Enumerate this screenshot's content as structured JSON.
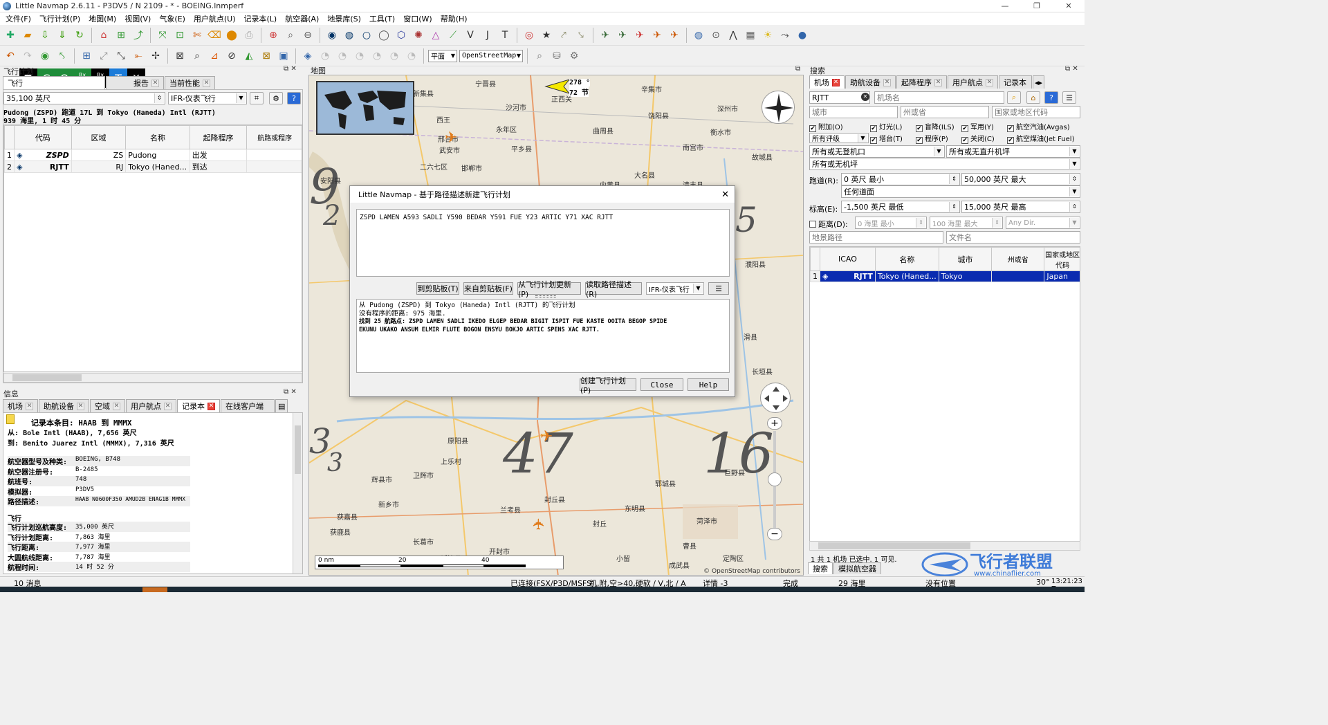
{
  "window": {
    "title": "Little Navmap 2.6.11 - P3DV5 / N 2109 - * - BOEING.lnmperf",
    "controls": [
      "—",
      "❐",
      "✕"
    ]
  },
  "menu": [
    "文件(F)",
    "飞行计划(P)",
    "地图(M)",
    "视图(V)",
    "气象(E)",
    "用户航点(U)",
    "记录本(L)",
    "航空器(A)",
    "地景库(S)",
    "工具(T)",
    "窗口(W)",
    "帮助(H)"
  ],
  "toolbar2": {
    "projection": "平面",
    "map_theme": "OpenStreetMap"
  },
  "overlay_badge": [
    "C",
    "O",
    "Rx",
    "Tx",
    "Rx",
    "Tx",
    "T",
    "✕"
  ],
  "flightplan_panel": {
    "title": "飞行计划",
    "tabs": [
      "飞行",
      "报告",
      "当前性能"
    ],
    "altitude": "35,100 英尺",
    "flight_type": "IFR-仪表飞行",
    "route_heading": "Pudong (ZSPD) 跑道 17L 到 Tokyo (Haneda) Intl (RJTT)",
    "route_summary": "939 海里, 1 时 45 分",
    "columns": [
      "代码",
      "区域",
      "名称",
      "起降程序",
      "航路或程序"
    ],
    "rows": [
      {
        "num": "1",
        "code": "ZSPD",
        "region": "ZS",
        "name": "Pudong",
        "procedure": "出发",
        "airway": ""
      },
      {
        "num": "2",
        "code": "RJTT",
        "region": "RJ",
        "name": "Tokyo (Haned...",
        "procedure": "到达",
        "airway": ""
      }
    ]
  },
  "info_panel": {
    "title": "信息",
    "tabs": [
      "机场",
      "助航设备",
      "空域",
      "用户航点",
      "记录本",
      "在线客户端"
    ],
    "entry_title": "记录本条目: HAAB 到 MMMX",
    "from_label": "从:",
    "from_value": "Bole Intl (HAAB), 7,656 英尺",
    "to_label": "到:",
    "to_value": "Benito Juarez Intl (MMMX), 7,316 英尺",
    "details": [
      {
        "k": "航空器型号及种类:",
        "v": "BOEING, B748"
      },
      {
        "k": "航空器注册号:",
        "v": "B-2485"
      },
      {
        "k": "航班号:",
        "v": "748"
      },
      {
        "k": "模拟器:",
        "v": "P3DV5"
      },
      {
        "k": "路径描述:",
        "v": "HAAB N0600F350 AMUD2B ENAG1B MMMX"
      }
    ],
    "flight_section": "飞行",
    "flight_details": [
      {
        "k": "飞行计划巡航高度:",
        "v": "35,000 英尺"
      },
      {
        "k": "飞行计划距离:",
        "v": "7,863 海里"
      },
      {
        "k": "飞行距离:",
        "v": "7,977 海里"
      },
      {
        "k": "大圆航线距离:",
        "v": "7,787 海里"
      },
      {
        "k": "航程时间:",
        "v": "14 时 52 分"
      }
    ]
  },
  "map_panel": {
    "title": "地图",
    "heading_label": "278 °",
    "speed_label": "72 节",
    "copyright": "© OpenStreetMap contributors",
    "scale": [
      "0 nm",
      "20",
      "40"
    ],
    "big_numbers": [
      "9",
      "2",
      "5",
      "3",
      "3",
      "47",
      "16"
    ],
    "towns": [
      "宁晋县",
      "辛集市",
      "新集县",
      "沙河市",
      "正西关",
      "深州市",
      "衡水市",
      "西王",
      "永年区",
      "饶阳县",
      "邢台市",
      "大名县",
      "邯郸市",
      "曲周县",
      "武安市",
      "平乡县",
      "二六七区",
      "南宫市",
      "故城县",
      "安阳县",
      "清丰县",
      "内黄县",
      "濮阳县",
      "滑县",
      "长垣县",
      "东明县",
      "兰考县",
      "开封市",
      "封丘县",
      "原阳县",
      "新乡市",
      "获嘉县",
      "辉县市",
      "卫辉市",
      "上乐村",
      "获鹿县",
      "长葛市",
      "延津县",
      "封丘",
      "菏泽市",
      "定陶区",
      "曹县",
      "成武县",
      "巨野县",
      "郓城县",
      "小留"
    ]
  },
  "dialog": {
    "title": "Little Navmap - 基于路径描述新建飞行计划",
    "route_input": "ZSPD LAMEN A593 SADLI Y590 BEDAR Y591 FUE Y23 ARTIC Y71 XAC RJTT",
    "buttons": {
      "to_clipboard": "到剪贴板(T)",
      "from_clipboard": "来自剪贴板(F)",
      "update_from_plan": "从飞行计划更新(P)",
      "read_route": "读取路径描述(R)",
      "flight_type": "IFR-仪表飞行",
      "create_plan": "创建飞行计划(P)",
      "close": "Close",
      "help": "Help"
    },
    "result_line1": "从 Pudong (ZSPD) 到 Tokyo (Haneda) Intl (RJTT) 的飞行计划",
    "result_line2": "没有程序的距离: 975 海里.",
    "result_line3": "找到 25 航路点: ZSPD LAMEN SADLI IKEDO ELGEP BEDAR BIGIT ISPIT FUE KASTE OOITA BEGOP SPIDE",
    "result_line4": "EKUNU UKAKO ANSUM ELMIR FLUTE BOGON ENSYU BOKJO ARTIC SPENS XAC RJTT."
  },
  "search_panel": {
    "title": "搜索",
    "tabs": [
      "机场",
      "助航设备",
      "起降程序",
      "用户航点",
      "记录本"
    ],
    "ident_value": "RJTT",
    "name_placeholder": "机场名",
    "city_placeholder": "城市",
    "state_placeholder": "州或省",
    "country_placeholder": "国家或地区代码",
    "checks": [
      {
        "label": "附加(O)",
        "checked": true
      },
      {
        "label": "灯光(L)",
        "checked": true
      },
      {
        "label": "盲降(ILS)",
        "checked": true
      },
      {
        "label": "军用(Y)",
        "checked": true
      },
      {
        "label": "航空汽油(Avgas)",
        "checked": true
      },
      {
        "label": "塔台(T)",
        "checked": true
      },
      {
        "label": "程序(P)",
        "checked": true
      },
      {
        "label": "关闭(C)",
        "checked": true
      },
      {
        "label": "航空煤油(Jet Fuel)",
        "checked": true
      }
    ],
    "rating": "所有评级",
    "apron": "所有或无登机口",
    "helipad": "所有或无直升机坪",
    "ramp": "所有或无机坪",
    "runway_label": "跑道(R):",
    "runway_min": "0 英尺 最小",
    "runway_max": "50,000 英尺 最大",
    "surface": "任何道面",
    "elevation_label": "标高(E):",
    "elev_min": "-1,500 英尺 最低",
    "elev_max": "15,000 英尺 最高",
    "distance_label": "距离(D):",
    "dist_min": "0 海里 最小",
    "dist_max": "100 海里 最大",
    "dist_dir": "Any Dir.",
    "scenery_placeholder": "地景路径",
    "file_placeholder": "文件名",
    "columns": [
      "ICAO",
      "名称",
      "城市",
      "州或省",
      "国家或地区代码"
    ],
    "results": [
      {
        "num": "1",
        "icao": "RJTT",
        "name": "Tokyo (Haned...",
        "city": "Tokyo",
        "state": "",
        "country": "Japan"
      }
    ],
    "footer": "1 共 1 机场 已选中. 1 可见.",
    "bottom_tabs": [
      "搜索",
      "模拟航空器"
    ]
  },
  "watermark": {
    "brand": "飞行者联盟",
    "url": "www.chinaflier.com"
  },
  "statusbar": {
    "messages": "10 消息",
    "sim": "已连接(FSX/P3D/MSFS)",
    "filter": "机,附,空>40,硬软 / V,北 / A",
    "detail": "详情 -3",
    "done": "完成",
    "distance": "29 海里",
    "position": "没有位置",
    "heading": "30°",
    "time": "13:21:23 Z"
  }
}
